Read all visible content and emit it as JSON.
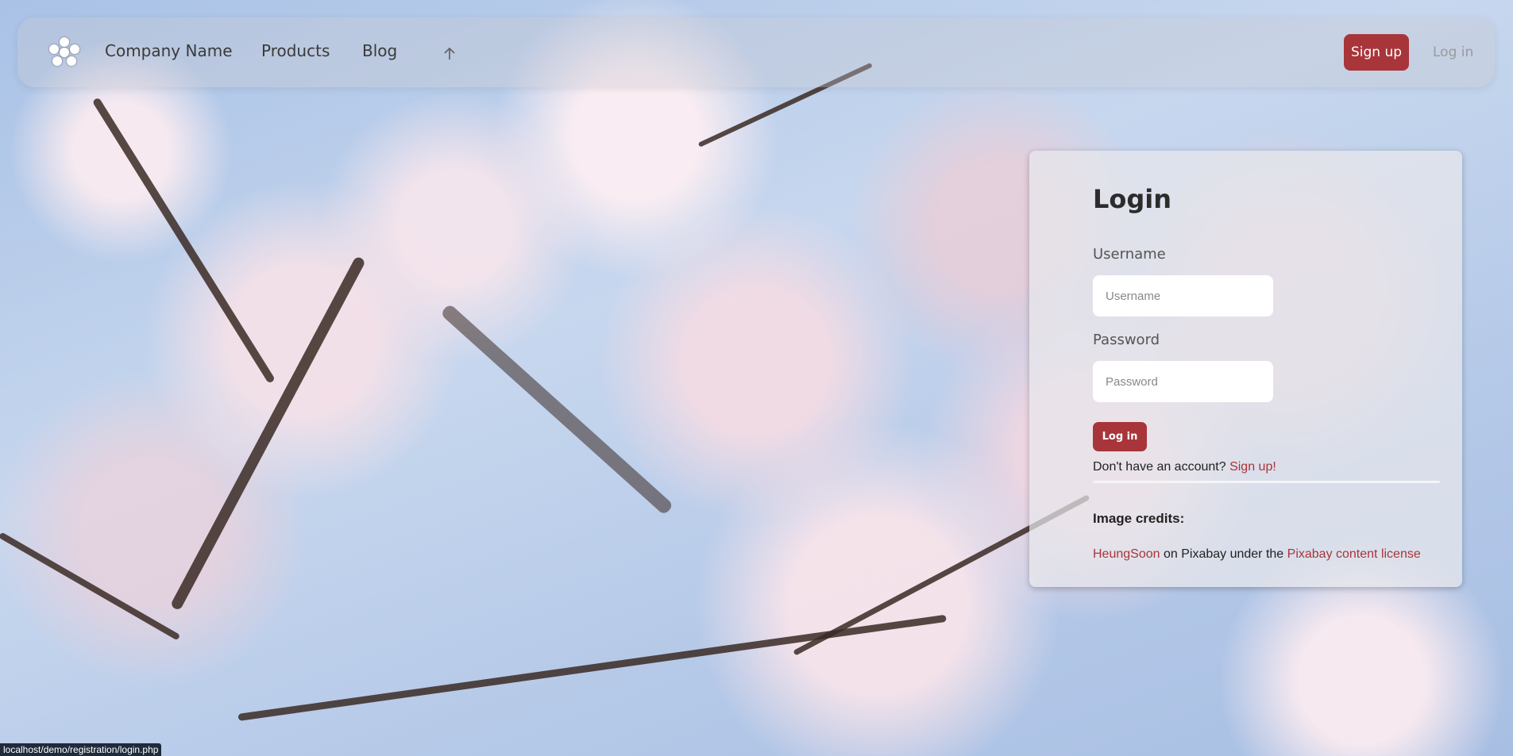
{
  "nav": {
    "logo_icon": "flower-dots-logo-icon",
    "company_name": "Company Name",
    "products": "Products",
    "blog": "Blog",
    "up_icon": "arrow-up-icon",
    "signup_label": "Sign up",
    "login_label": "Log in"
  },
  "login": {
    "title": "Login",
    "username_label": "Username",
    "username_placeholder": "Username",
    "password_label": "Password",
    "password_placeholder": "Password",
    "submit_label": "Log in",
    "no_account_text": "Don't have an account?",
    "signup_link": "Sign up!"
  },
  "credits": {
    "title": "Image credits:",
    "author": "HeungSoon",
    "middle_text": "on Pixabay under the",
    "license": "Pixabay content license"
  },
  "status_bar": {
    "url": "localhost/demo/registration/login.php"
  },
  "colors": {
    "accent": "#a8353a",
    "text": "#2c2c2c"
  }
}
